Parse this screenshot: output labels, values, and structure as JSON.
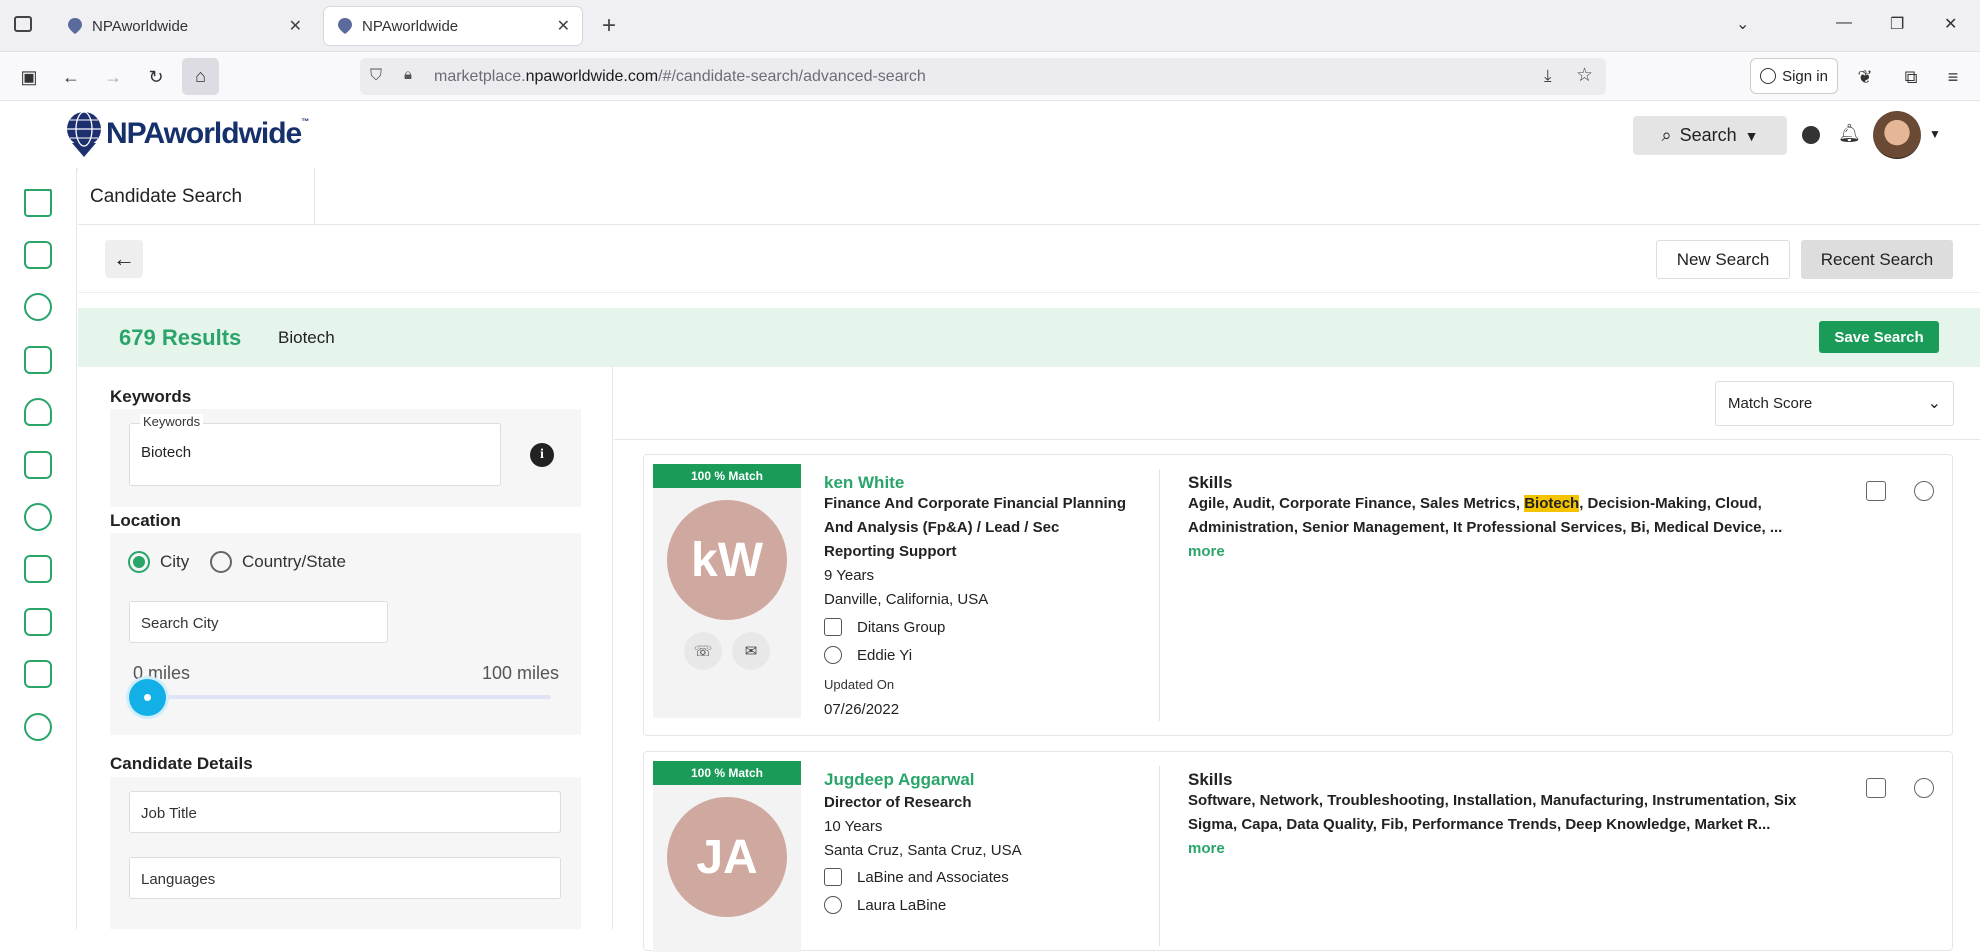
{
  "browser": {
    "tabs": [
      {
        "title": "NPAworldwide",
        "active": false
      },
      {
        "title": "NPAworldwide",
        "active": true
      }
    ],
    "url_prefix": "marketplace.",
    "url_domain": "npaworldwide.com",
    "url_path": "/#/candidate-search/advanced-search",
    "signin_label": "Sign in"
  },
  "header": {
    "logo_text": "NPAworldwide",
    "logo_tm": "™",
    "search_label": "Search"
  },
  "sidebar": {
    "items": [
      "home-icon",
      "dashboard-icon",
      "person-icon",
      "briefcase-icon",
      "candidate-icon",
      "document-icon",
      "money-icon",
      "folder-icon",
      "task-icon",
      "report-icon",
      "settings-user-icon"
    ]
  },
  "page": {
    "title": "Candidate Search",
    "new_search_label": "New Search",
    "recent_search_label": "Recent Search",
    "results_count": "679 Results",
    "results_keyword": "Biotech",
    "save_search_label": "Save Search"
  },
  "filters": {
    "keywords_heading": "Keywords",
    "keywords_field_label": "Keywords",
    "keywords_value": "Biotech",
    "location_heading": "Location",
    "radio_city": "City",
    "radio_country": "Country/State",
    "city_placeholder": "Search City",
    "range_min": "0 miles",
    "range_max": "100 miles",
    "range_value": 0,
    "details_heading": "Candidate Details",
    "job_title_placeholder": "Job Title",
    "languages_placeholder": "Languages"
  },
  "sort": {
    "selected": "Match Score"
  },
  "candidates": [
    {
      "match": "100 % Match",
      "initials": "kW",
      "name": "ken White",
      "title": "Finance And Corporate Financial Planning And Analysis (Fp&A) / Lead / Sec Reporting Support",
      "experience": "9 Years",
      "location": "Danville, California, USA",
      "company": "Ditans Group",
      "recruiter": "Eddie Yi",
      "updated_label": "Updated On",
      "updated_date": "07/26/2022",
      "skills_heading": "Skills",
      "skills_before": "Agile, Audit, Corporate Finance, Sales Metrics, ",
      "skills_highlight": "Biotech",
      "skills_after": ", Decision-Making, Cloud, Administration, Senior Management, It Professional Services, Bi, Medical Device, ... ",
      "more_label": "more"
    },
    {
      "match": "100 % Match",
      "initials": "JA",
      "name": "Jugdeep Aggarwal",
      "title": "Director of Research",
      "experience": "10 Years",
      "location": "Santa Cruz, Santa Cruz, USA",
      "company": "LaBine and Associates",
      "recruiter": "Laura LaBine",
      "skills_heading": "Skills",
      "skills_text": "Software, Network, Troubleshooting, Installation, Manufacturing, Instrumentation, Six Sigma, Capa, Data Quality, Fib, Performance Trends, Deep Knowledge, Market R... ",
      "more_label": "more"
    }
  ]
}
